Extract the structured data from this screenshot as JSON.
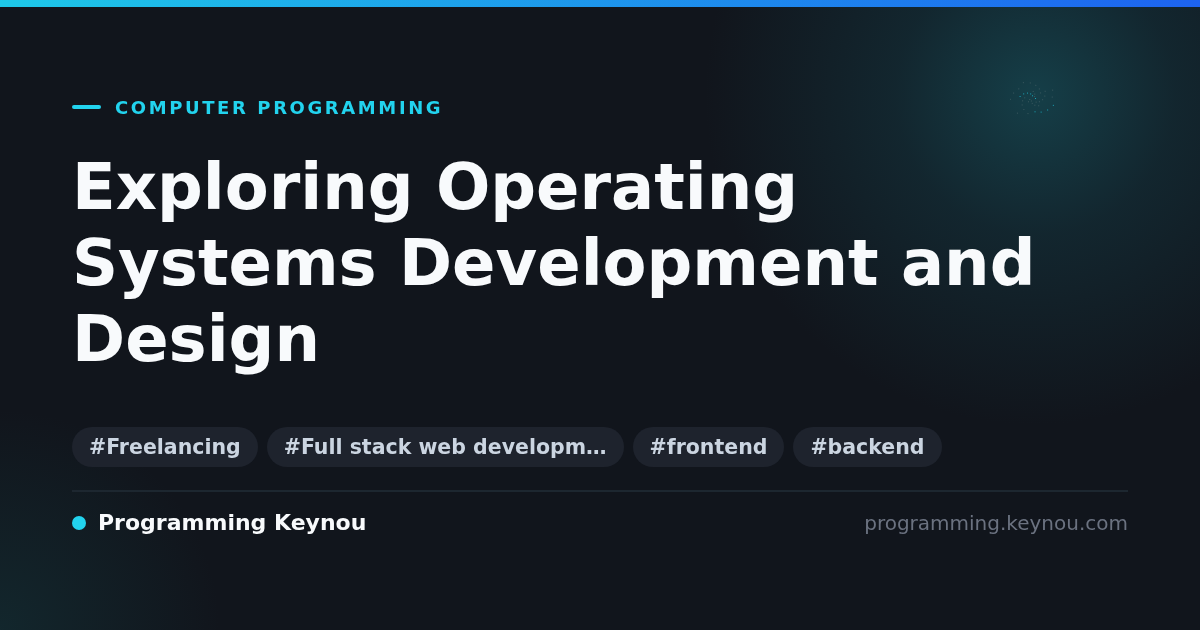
{
  "category": "COMPUTER PROGRAMMING",
  "title": "Exploring Operating Systems Development and Design",
  "tags": [
    "#Freelancing",
    "#Full stack web developm…",
    "#frontend",
    "#backend"
  ],
  "footer": {
    "site_name": "Programming Keynou",
    "url": "programming.keynou.com"
  }
}
